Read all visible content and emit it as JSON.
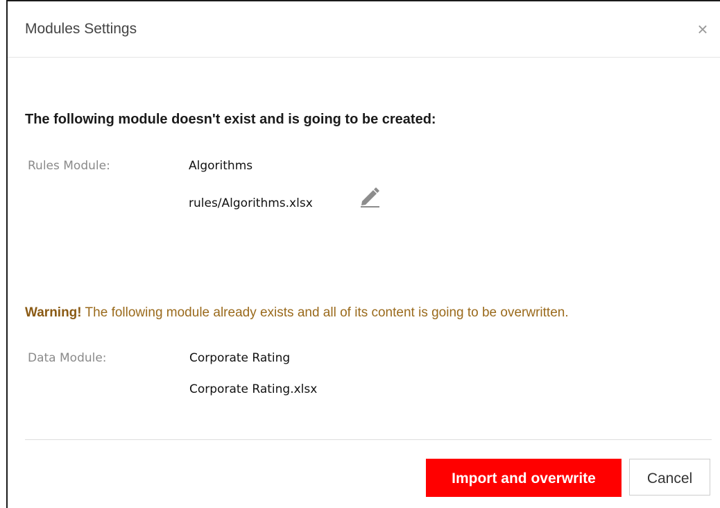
{
  "dialog": {
    "title": "Modules Settings",
    "close_symbol": "×"
  },
  "create_section": {
    "heading": "The following module doesn't exist and is going to be created:",
    "label": "Rules Module:",
    "module_name": "Algorithms",
    "file_path": "rules/Algorithms.xlsx",
    "edit_icon": "pencil-icon"
  },
  "overwrite_section": {
    "warning_prefix": "Warning!",
    "warning_text": " The following module already exists and all of its content is going to be overwritten.",
    "label": "Data Module:",
    "module_name": "Corporate Rating",
    "file_name": "Corporate Rating.xlsx"
  },
  "buttons": {
    "primary_label": "Import and overwrite",
    "cancel_label": "Cancel"
  },
  "colors": {
    "primary_button": "#ff0000",
    "warning_text": "#9a6a1c"
  }
}
